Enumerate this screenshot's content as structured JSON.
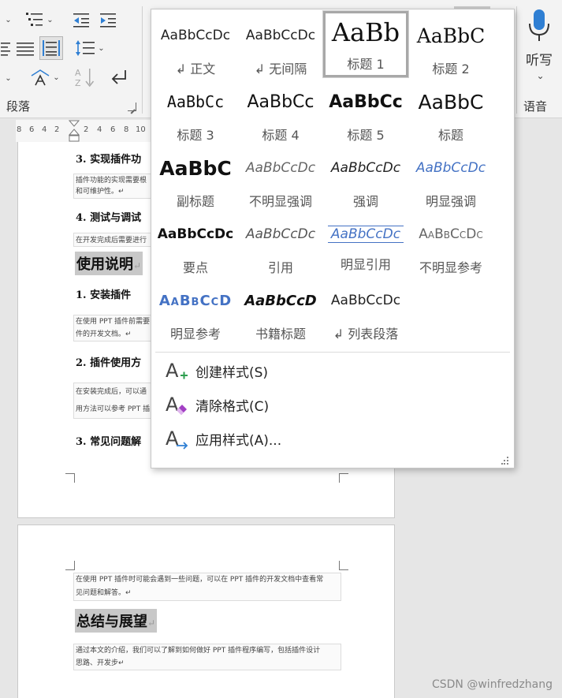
{
  "ribbon": {
    "paragraph_group_label": "段落",
    "voice_group_label": "语音",
    "dictate_label": "听写"
  },
  "ruler": {
    "numbers": [
      "8",
      "6",
      "4",
      "2",
      "2",
      "4",
      "6",
      "8",
      "10"
    ]
  },
  "document": {
    "page1": {
      "item3_heading": "3.  实现插件功",
      "item3_text_line1": "插件功能的实现需要根",
      "item3_text_line2": "和可维护性。↵",
      "item4_heading": "4.  测试与调试",
      "item4_text": "在开发完成后需要进行",
      "usage_heading": "使用说明",
      "usage_item1_heading": "1.  安装插件",
      "usage_item1_text_line1": "在使用 PPT 插件前需要",
      "usage_item1_text_line2": "件的开发文档。↵",
      "usage_item2_heading": "2.  插件使用方",
      "usage_item2_text_line1": "在安装完成后，可以通",
      "usage_item2_text_line2": "用方法可以参考 PPT 插",
      "usage_item3_heading": "3.  常见问题解"
    },
    "page2": {
      "faq_text_line1": "在使用 PPT 插件时可能会遇到一些问题，可以在 PPT 插件的开发文档中查看常",
      "faq_text_line2": "见问题和解答。↵",
      "summary_heading": "总结与展望",
      "summary_text_line1": "通过本文的介绍，我们可以了解到如何做好 PPT 插件程序编写，包括插件设计",
      "summary_text_line2": "思路、开发步↵"
    },
    "paragraph_mark": "↵"
  },
  "styles_gallery": {
    "tiles": [
      {
        "preview": "AaBbCcDc",
        "name": "↲ 正文"
      },
      {
        "preview": "AaBbCcDc",
        "name": "↲ 无间隔"
      },
      {
        "preview": "AaBb",
        "name": "标题 1",
        "selected": true
      },
      {
        "preview": "AaBbC",
        "name": "标题 2"
      },
      {
        "preview": "AaBbCc",
        "name": "标题 3"
      },
      {
        "preview": "AaBbCc",
        "name": "标题 4"
      },
      {
        "preview": "AaBbCc",
        "name": "标题 5"
      },
      {
        "preview": "AaBbC",
        "name": "标题"
      },
      {
        "preview": "AaBbC",
        "name": "副标题"
      },
      {
        "preview": "AaBbCcDc",
        "name": "不明显强调"
      },
      {
        "preview": "AaBbCcDc",
        "name": "强调"
      },
      {
        "preview": "AaBbCcDc",
        "name": "明显强调"
      },
      {
        "preview": "AaBbCcDc",
        "name": "要点"
      },
      {
        "preview": "AaBbCcDc",
        "name": "引用"
      },
      {
        "preview": "AaBbCcDc",
        "name": "明显引用"
      },
      {
        "preview": "AaBbCcDc",
        "name": "不明显参考"
      },
      {
        "preview": "AaBbCcD",
        "name": "明显参考"
      },
      {
        "preview": "AaBbCcD",
        "name": "书籍标题"
      },
      {
        "preview": "AaBbCcDc",
        "name": "↲ 列表段落"
      }
    ],
    "menu": {
      "create_style": "创建样式(S)",
      "clear_format": "清除格式(C)",
      "apply_style": "应用样式(A)..."
    }
  },
  "colors": {
    "accent_blue": "#4472c4",
    "clear_format_purple": "#a23fc4",
    "create_style_green": "#2e9e4f",
    "apply_style_blue": "#2f7fd3"
  },
  "watermark": "CSDN @winfredzhang"
}
